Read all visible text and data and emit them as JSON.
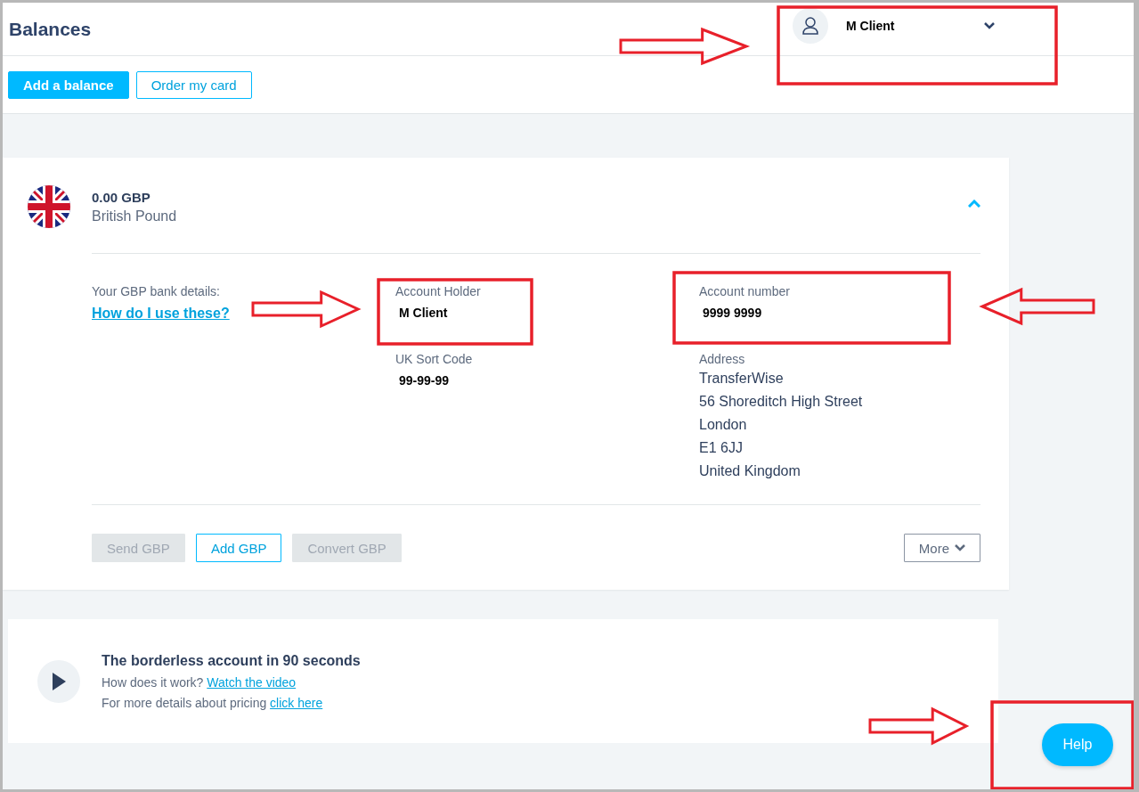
{
  "header": {
    "title": "Balances",
    "user": {
      "name": "M Client"
    }
  },
  "actions": [
    {
      "label": "Add a balance",
      "kind": "primary"
    },
    {
      "label": "Order my card",
      "kind": "outline"
    }
  ],
  "balance": {
    "amount": "0.00 GBP",
    "currency": "British Pound",
    "expanded": true,
    "details_label": "Your GBP bank details:",
    "help_link": "How do I use these?",
    "holder": {
      "label": "Account Holder",
      "value": "M Client"
    },
    "sort_code": {
      "label": "UK Sort Code",
      "value": "99-99-99"
    },
    "account_number": {
      "label": "Account number",
      "value": "9999 9999"
    },
    "address": {
      "label": "Address",
      "lines": [
        "TransferWise",
        "56 Shoreditch High Street",
        "London",
        "E1 6JJ",
        "United Kingdom"
      ]
    },
    "buttons": [
      {
        "label": "Send GBP",
        "disabled": true
      },
      {
        "label": "Add GBP",
        "disabled": false
      },
      {
        "label": "Convert GBP",
        "disabled": true
      }
    ],
    "more": "More"
  },
  "video": {
    "title": "The borderless account in 90 seconds",
    "lines": [
      {
        "text": "How does it work?",
        "link": "Watch the video"
      },
      {
        "text": "For more details about pricing",
        "link": "click here"
      }
    ]
  },
  "help": "Help"
}
